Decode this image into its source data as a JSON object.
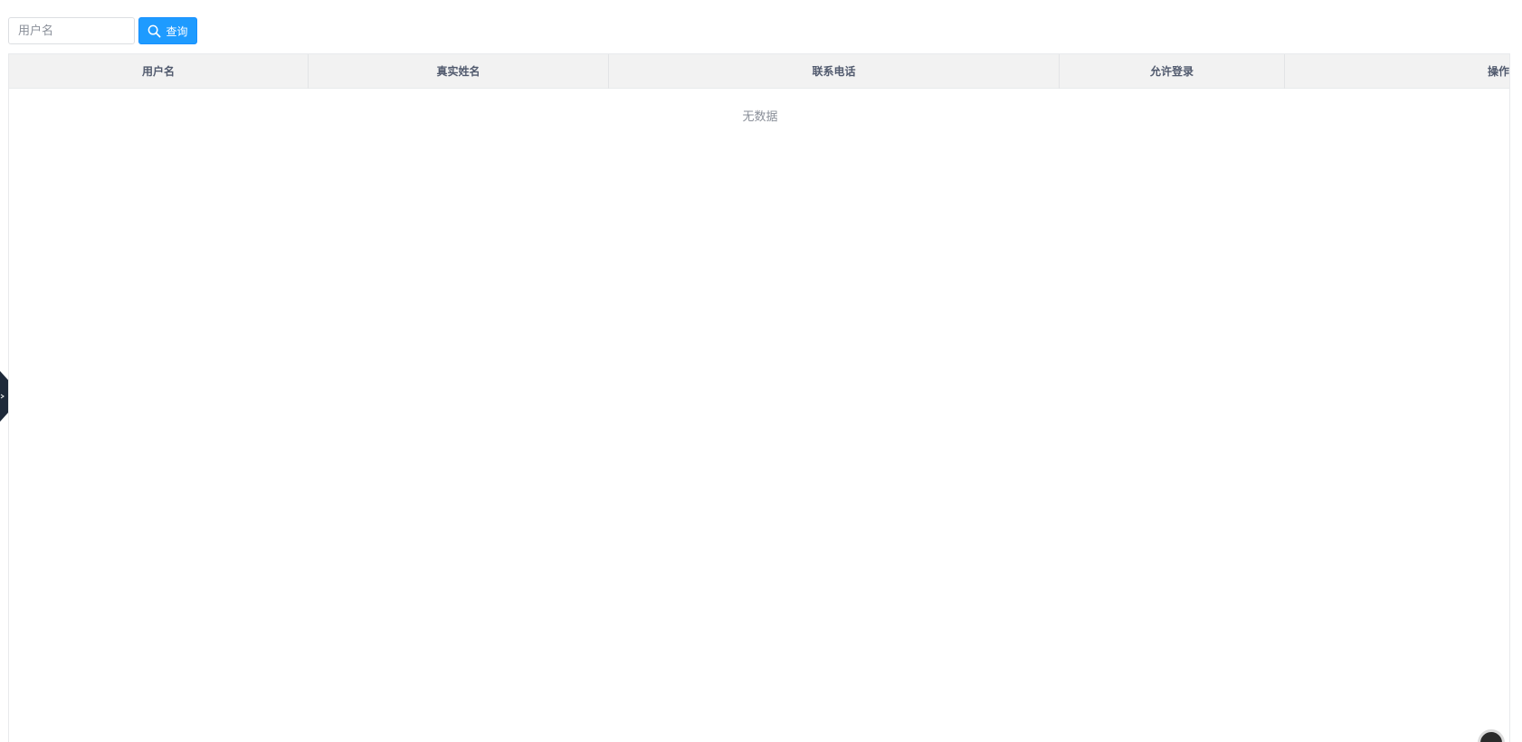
{
  "search": {
    "placeholder": "用户名",
    "value": ""
  },
  "toolbar": {
    "query_label": "查询",
    "query_icon": "search-icon",
    "accent_color": "#1e9bff"
  },
  "table": {
    "columns": [
      "用户名",
      "真实姓名",
      "联系电话",
      "允许登录",
      "操作"
    ],
    "empty_text": "无数据"
  },
  "side_tab": {
    "icon": "chevron-left-icon",
    "color": "#1e2a3a"
  }
}
